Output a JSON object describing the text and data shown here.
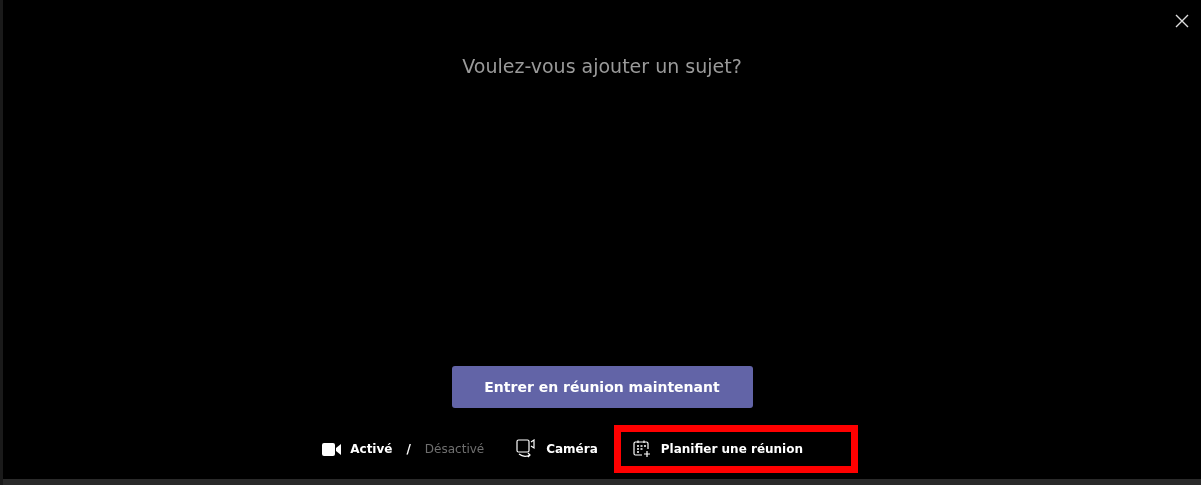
{
  "subject_field": {
    "placeholder": "Voulez-vous ajouter un sujet?"
  },
  "join_button": {
    "label": "Entrer en réunion maintenant"
  },
  "video_toggle": {
    "on": true,
    "on_label": "Activé",
    "separator": "/",
    "off_label": "Désactivé"
  },
  "camera_button": {
    "label": "Caméra"
  },
  "schedule_button": {
    "label": "Planifier une réunion",
    "highlighted": true
  }
}
